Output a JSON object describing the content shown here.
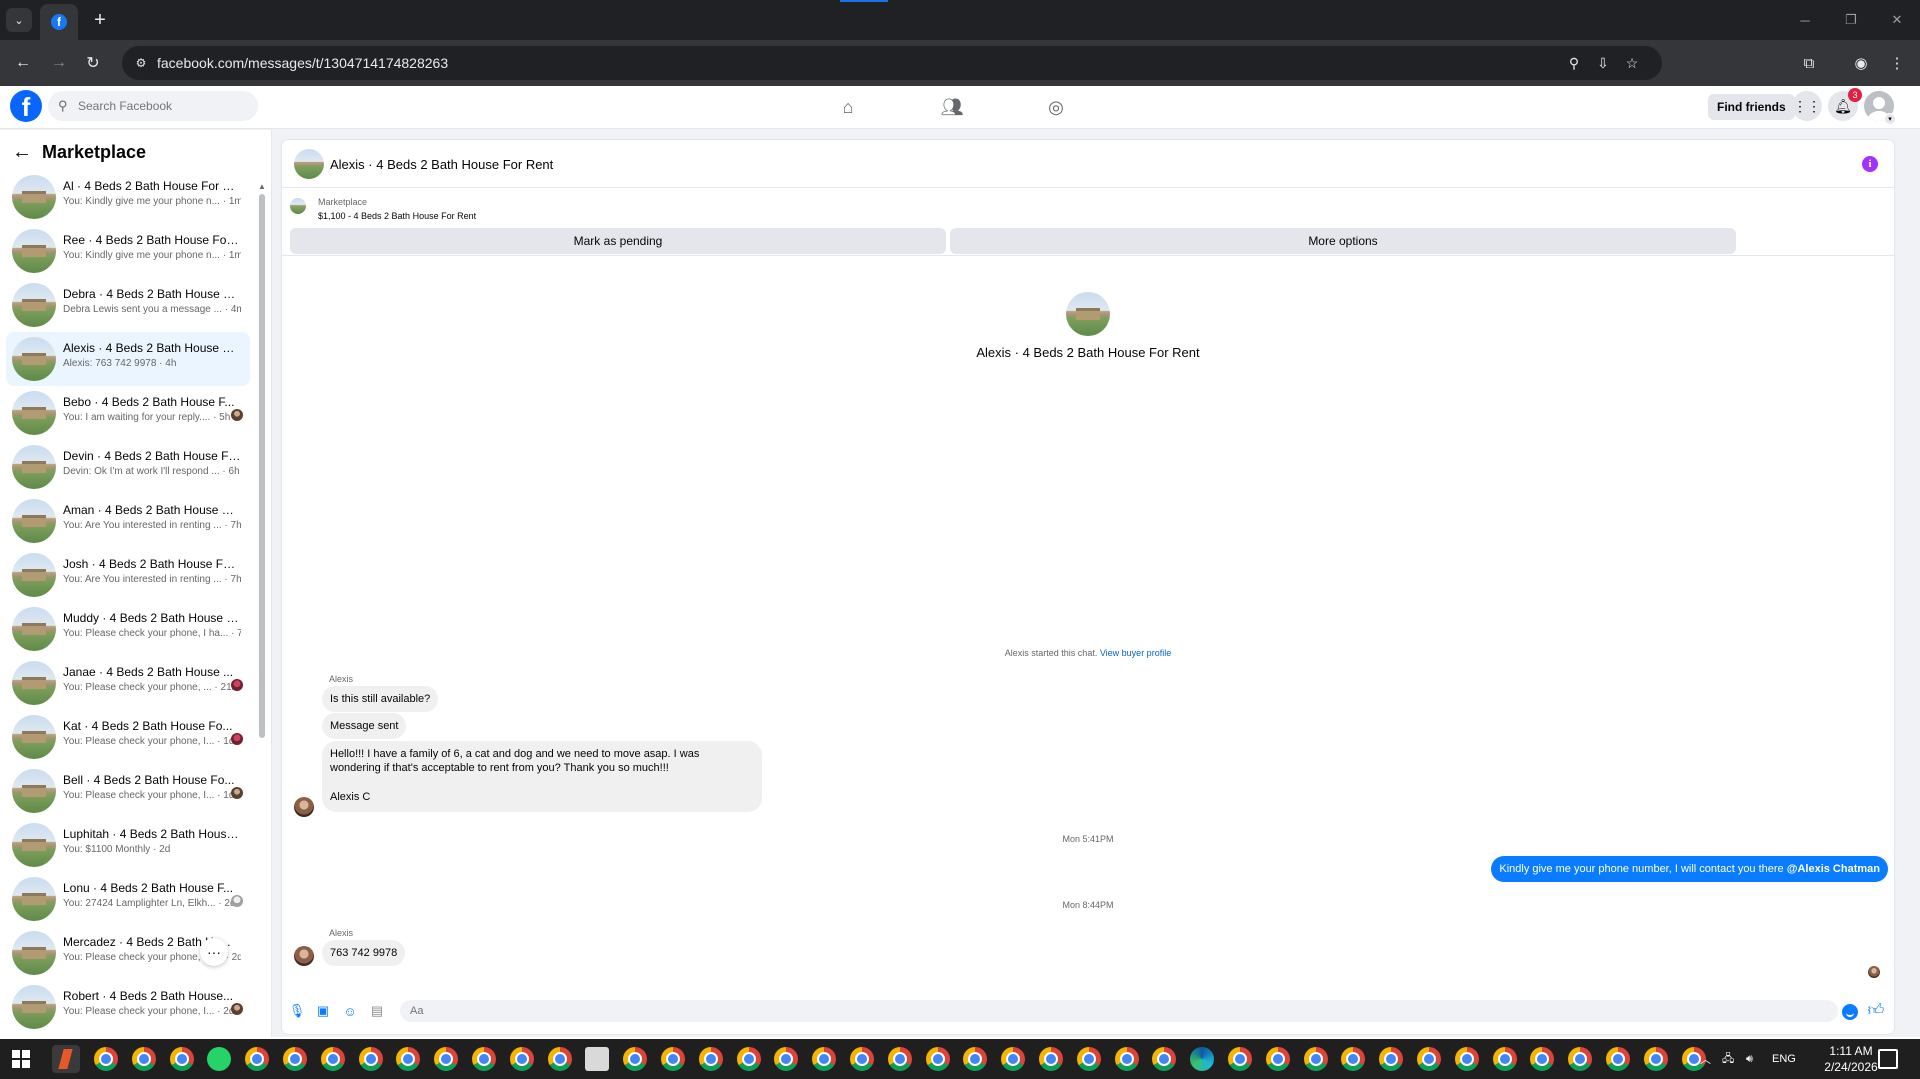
{
  "browser": {
    "url": "facebook.com/messages/t/1304714174828263",
    "tab_icon": "facebook-icon"
  },
  "header": {
    "logo": "f",
    "search_placeholder": "Search Facebook",
    "find_friends_label": "Find friends",
    "notification_count": "3",
    "icons": [
      "home-icon",
      "friends-icon",
      "groups-icon",
      "menu-grid-icon",
      "bell-icon"
    ]
  },
  "sidebar": {
    "title": "Marketplace",
    "conversations": [
      {
        "name": "Al · 4 Beds 2 Bath House For Rent",
        "preview": "You: Kindly give me your phone n... · 1m",
        "avatar_seen": ""
      },
      {
        "name": "Ree · 4 Beds 2 Bath House For ...",
        "preview": "You: Kindly give me your phone n... · 1m",
        "avatar_seen": ""
      },
      {
        "name": "Debra · 4 Beds 2 Bath House Fo...",
        "preview": "Debra Lewis sent you a message ... · 4m",
        "avatar_seen": ""
      },
      {
        "name": "Alexis · 4 Beds 2 Bath House Fo...",
        "preview": "Alexis: 763 742 9978 · 4h",
        "avatar_seen": "",
        "active": true
      },
      {
        "name": "Bebo · 4 Beds 2 Bath House F...",
        "preview": "You: I am waiting for your reply.... · 5h",
        "avatar_seen": "brown"
      },
      {
        "name": "Devin · 4 Beds 2 Bath House Fo...",
        "preview": "Devin: Ok I'm at work I'll respond ... · 6h",
        "avatar_seen": ""
      },
      {
        "name": "Aman · 4 Beds 2 Bath House Fo...",
        "preview": "You: Are You interested in renting ... · 7h",
        "avatar_seen": ""
      },
      {
        "name": "Josh · 4 Beds 2 Bath House For ...",
        "preview": "You: Are You interested in renting ... · 7h",
        "avatar_seen": ""
      },
      {
        "name": "Muddy · 4 Beds 2 Bath House F...",
        "preview": "You: Please check your phone, I ha... · 7h",
        "avatar_seen": ""
      },
      {
        "name": "Janae · 4 Beds 2 Bath House ...",
        "preview": "You: Please check your phone, ... · 21h",
        "avatar_seen": "red"
      },
      {
        "name": "Kat · 4 Beds 2 Bath House Fo...",
        "preview": "You: Please check your phone, I... · 1d",
        "avatar_seen": "red"
      },
      {
        "name": "Bell · 4 Beds 2 Bath House Fo...",
        "preview": "You: Please check your phone, I... · 1d",
        "avatar_seen": "brown"
      },
      {
        "name": "Luphitah · 4 Beds 2 Bath House...",
        "preview": "You: $1100 Monthly · 2d",
        "avatar_seen": ""
      },
      {
        "name": "Lonu · 4 Beds 2 Bath House F...",
        "preview": "You: 27424 Lamplighter Ln, Elkh... · 2d",
        "avatar_seen": "grey"
      },
      {
        "name": "Mercadez · 4 Beds 2 Bath Ho...",
        "preview": "You: Please check your phone, I h... · 2d",
        "avatar_seen": ""
      },
      {
        "name": "Robert · 4 Beds 2 Bath House...",
        "preview": "You: Please check your phone, I... · 2d",
        "avatar_seen": "brown"
      }
    ],
    "more_label": "···"
  },
  "chat": {
    "title": "Alexis · 4 Beds 2 Bath House For Rent",
    "listing": {
      "label": "Marketplace",
      "title": "$1,100 - 4 Beds 2 Bath House For Rent",
      "btn_pending": "Mark as pending",
      "btn_more": "More options"
    },
    "intro_title": "Alexis · 4 Beds 2 Bath House For Rent",
    "started_text": "Alexis started this chat. ",
    "view_profile": "View buyer profile",
    "messages": {
      "sender1": "Alexis",
      "m1": "Is this still available?",
      "m2": "Message sent",
      "m3_line1": "Hello!!! I have a family of 6, a cat and dog and we need to move asap. I was",
      "m3_line2": "wondering if that's acceptable to rent from you? Thank you so much!!!",
      "m3_sign": "Alexis C",
      "ts1": "Mon 5:41PM",
      "out1_text": "Kindly give me your phone number, I will contact you there ",
      "out1_mention": "@Alexis Chatman",
      "ts2": "Mon 8:44PM",
      "sender2": "Alexis",
      "m4": "763 742 9978"
    },
    "composer_placeholder": "Aa"
  },
  "taskbar": {
    "lang": "ENG",
    "time": "1:11 AM",
    "date": "2/24/2026"
  }
}
